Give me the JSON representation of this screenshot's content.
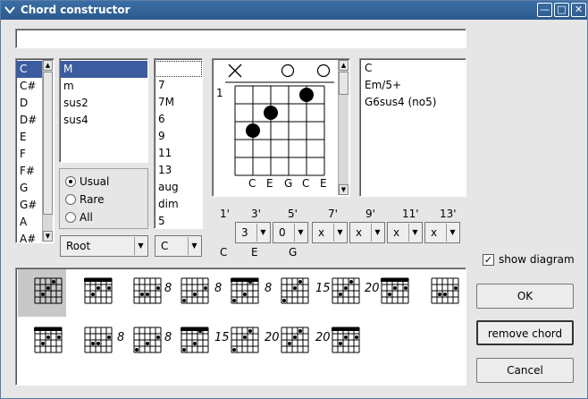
{
  "window": {
    "title": "Chord constructor"
  },
  "name_input": {
    "value": ""
  },
  "tonic_list": [
    "C",
    "C#",
    "D",
    "D#",
    "E",
    "F",
    "F#",
    "G",
    "G#",
    "A",
    "A#"
  ],
  "tonic_selected": "C",
  "type_list": [
    "M",
    "m",
    "sus2",
    "sus4"
  ],
  "type_selected": "M",
  "ext_list": [
    "",
    "7",
    "7M",
    "6",
    "9",
    "11",
    "13",
    "aug",
    "dim",
    "5"
  ],
  "step_options": {
    "usual": "Usual",
    "rare": "Rare",
    "all": "All",
    "selected": "Usual"
  },
  "inversion_combo": {
    "value": "Root"
  },
  "bass_combo": {
    "value": "C"
  },
  "fretboard": {
    "start_fret": "1",
    "string_notes": [
      "C",
      "E",
      "G",
      "C",
      "E"
    ],
    "markers": [
      "×",
      "",
      "",
      "",
      "○",
      "○"
    ]
  },
  "chord_names": [
    "C",
    "Em/5+",
    "G6sus4 (no5)"
  ],
  "interval_headers": [
    "1'",
    "3'",
    "5'",
    "7'",
    "9'",
    "11'",
    "13'"
  ],
  "interval_values": [
    "3",
    "0",
    "x",
    "x",
    "x",
    "x"
  ],
  "interval_notes": [
    "C",
    "E",
    "G"
  ],
  "show_diagram": {
    "label": "show diagram",
    "checked": true
  },
  "buttons": {
    "ok": "OK",
    "remove": "remove chord",
    "cancel": "Cancel"
  },
  "variants_row1": [
    "",
    "",
    "",
    "8",
    "8",
    "8",
    "15",
    "20",
    ""
  ],
  "variants_row2": [
    "",
    "",
    "8",
    "8",
    "15",
    "20",
    "20"
  ]
}
